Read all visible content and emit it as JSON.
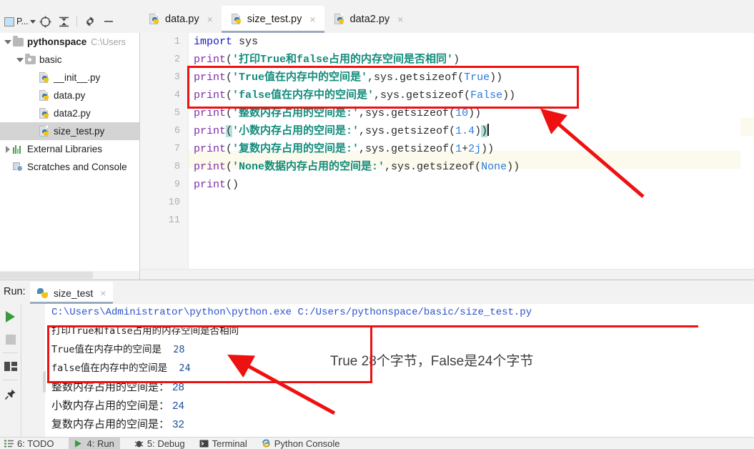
{
  "toolbar": {
    "project_chip_label": "P...",
    "icons": [
      "project-selector-icon",
      "target-icon",
      "collapse-all-icon",
      "settings-gear-icon",
      "hide-icon"
    ]
  },
  "editor_tabs": [
    {
      "label": "data.py",
      "active": false,
      "close": "×"
    },
    {
      "label": "size_test.py",
      "active": true,
      "close": "×"
    },
    {
      "label": "data2.py",
      "active": false,
      "close": "×"
    }
  ],
  "project_tree": [
    {
      "label": "pythonspace",
      "path": "C:\\Users",
      "indent": 0,
      "twisty": "down",
      "kind": "folder",
      "bold": true,
      "selected": false
    },
    {
      "label": "basic",
      "path": "",
      "indent": 1,
      "twisty": "down",
      "kind": "folder-dot",
      "bold": false,
      "selected": false
    },
    {
      "label": "__init__.py",
      "path": "",
      "indent": 2,
      "twisty": "none",
      "kind": "py",
      "bold": false,
      "selected": false
    },
    {
      "label": "data.py",
      "path": "",
      "indent": 2,
      "twisty": "none",
      "kind": "py",
      "bold": false,
      "selected": false
    },
    {
      "label": "data2.py",
      "path": "",
      "indent": 2,
      "twisty": "none",
      "kind": "py",
      "bold": false,
      "selected": false
    },
    {
      "label": "size_test.py",
      "path": "",
      "indent": 2,
      "twisty": "none",
      "kind": "py",
      "bold": false,
      "selected": true
    },
    {
      "label": "External Libraries",
      "path": "",
      "indent": 0,
      "twisty": "right",
      "kind": "lib",
      "bold": false,
      "selected": false
    },
    {
      "label": "Scratches and Console",
      "path": "",
      "indent": 0,
      "twisty": "none",
      "kind": "scratch",
      "bold": false,
      "selected": false
    }
  ],
  "editor": {
    "line_numbers": [
      "1",
      "2",
      "3",
      "4",
      "5",
      "6",
      "7",
      "8",
      "9",
      "10",
      "11"
    ],
    "highlighted_line": 6,
    "code_lines": [
      "import sys",
      "print('打印True和false占用的内存空间是否相同')",
      "print('True值在内存中的空间是',sys.getsizeof(True))",
      "print('false值在内存中的空间是',sys.getsizeof(False))",
      "print('整数内存占用的空间是:',sys.getsizeof(10))",
      "print('小数内存占用的空间是:',sys.getsizeof(1.4))",
      "print('复数内存占用的空间是:',sys.getsizeof(1+2j))",
      "print('None数据内存占用的空间是:',sys.getsizeof(None))",
      "print()"
    ],
    "tokens": {
      "kw_import": "import",
      "mod_sys": "sys",
      "fn_print": "print",
      "s1": "'打印True和false占用的内存空间是否相同'",
      "s2": "'True值在内存中的空间是'",
      "s3": "'false值在内存中的空间是'",
      "s4": "'整数内存占用的空间是:'",
      "s5": "'小数内存占用的空间是:'",
      "s6": "'复数内存占用的空间是:'",
      "s7": "'None数据内存占用的空间是:'",
      "call": ",sys.getsizeof(",
      "a_true": "True",
      "a_false": "False",
      "a_10": "10",
      "a_14": "1.4",
      "a_1": "1",
      "a_plus": "+",
      "a_2j": "2j",
      "a_none": "None",
      "close2": "))",
      "open1": "(",
      "close1": ")",
      "empty_call": "print()"
    }
  },
  "run_panel": {
    "label": "Run:",
    "tab_label": "size_test",
    "tab_close": "×",
    "toolbar_icons": [
      "run-icon",
      "stop-icon",
      "layout-icon",
      "pin-icon",
      "scroll-up-icon",
      "scroll-down-icon",
      "soft-wrap-icon",
      "scroll-to-end-icon",
      "more-icon"
    ],
    "console_lines": [
      "C:\\Users\\Administrator\\python\\python.exe C:/Users/pythonspace/basic/size_test.py",
      "打印True和false占用的内存空间是否相同",
      "True值在内存中的空间是  28",
      "false值在内存中的空间是  24",
      "整数内存占用的空间是： 28",
      "小数内存占用的空间是： 24",
      "复数内存占用的空间是： 32"
    ],
    "console_parts": {
      "l1_text": "打印True和false占用的内存空间是否相同",
      "l2_text": "True值在内存中的空间是  ",
      "l2_val": "28",
      "l3_text": "false值在内存中的空间是  ",
      "l3_val": "24",
      "l4_text": "整数内存占用的空间是： ",
      "l4_val": "28",
      "l5_text": "小数内存占用的空间是： ",
      "l5_val": "24",
      "l6_text": "复数内存占用的空间是： ",
      "l6_val": "32"
    }
  },
  "annotations": {
    "note_text": "True 28个字节，False是24个字节",
    "color": "#ee1111"
  },
  "status_bar": [
    {
      "label": "6: TODO",
      "active": false,
      "icon": "todo-icon"
    },
    {
      "label": "4: Run",
      "active": true,
      "icon": "run-icon"
    },
    {
      "label": "5: Debug",
      "active": false,
      "icon": "debug-icon"
    },
    {
      "label": "Terminal",
      "active": false,
      "icon": "terminal-icon"
    },
    {
      "label": "Python Console",
      "active": false,
      "icon": "python-console-icon"
    }
  ]
}
